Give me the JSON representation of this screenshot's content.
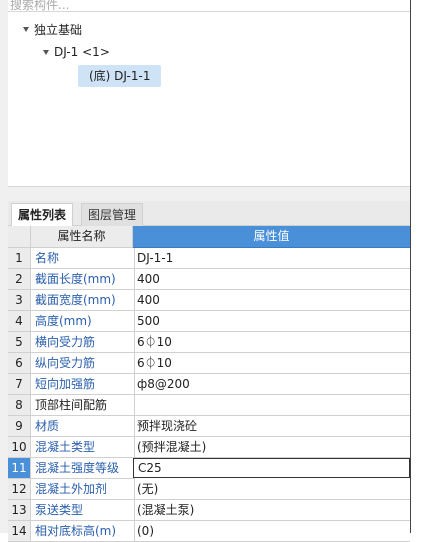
{
  "search": {
    "placeholder": "搜索构件..."
  },
  "tree": {
    "root": "独立基础",
    "child": "DJ-1 <1>",
    "leaf": "(底) DJ-1-1"
  },
  "tabs": [
    {
      "label": "属性列表"
    },
    {
      "label": "图层管理"
    }
  ],
  "table": {
    "header_name": "属性名称",
    "header_value": "属性值",
    "rows": [
      {
        "num": "1",
        "name": "名称",
        "value": "DJ-1-1"
      },
      {
        "num": "2",
        "name": "截面长度(mm)",
        "value": "400"
      },
      {
        "num": "3",
        "name": "截面宽度(mm)",
        "value": "400"
      },
      {
        "num": "4",
        "name": "高度(mm)",
        "value": "500"
      },
      {
        "num": "5",
        "name": "横向受力筋",
        "value": "6⏀10"
      },
      {
        "num": "6",
        "name": "纵向受力筋",
        "value": "6⏀10"
      },
      {
        "num": "7",
        "name": "短向加强筋",
        "value": "ф8@200"
      },
      {
        "num": "8",
        "name": "顶部柱间配筋",
        "value": ""
      },
      {
        "num": "9",
        "name": "材质",
        "value": "预拌现浇砼"
      },
      {
        "num": "10",
        "name": "混凝土类型",
        "value": "(预拌混凝土)"
      },
      {
        "num": "11",
        "name": "混凝土强度等级",
        "value": "C25"
      },
      {
        "num": "12",
        "name": "混凝土外加剂",
        "value": "(无)"
      },
      {
        "num": "13",
        "name": "泵送类型",
        "value": "(混凝土泵)"
      },
      {
        "num": "14",
        "name": "相对底标高(m)",
        "value": "(0)"
      }
    ]
  },
  "colors": {
    "accent": "#4a90d9",
    "link_text": "#2a5fad",
    "selection": "#cfe3f7"
  }
}
